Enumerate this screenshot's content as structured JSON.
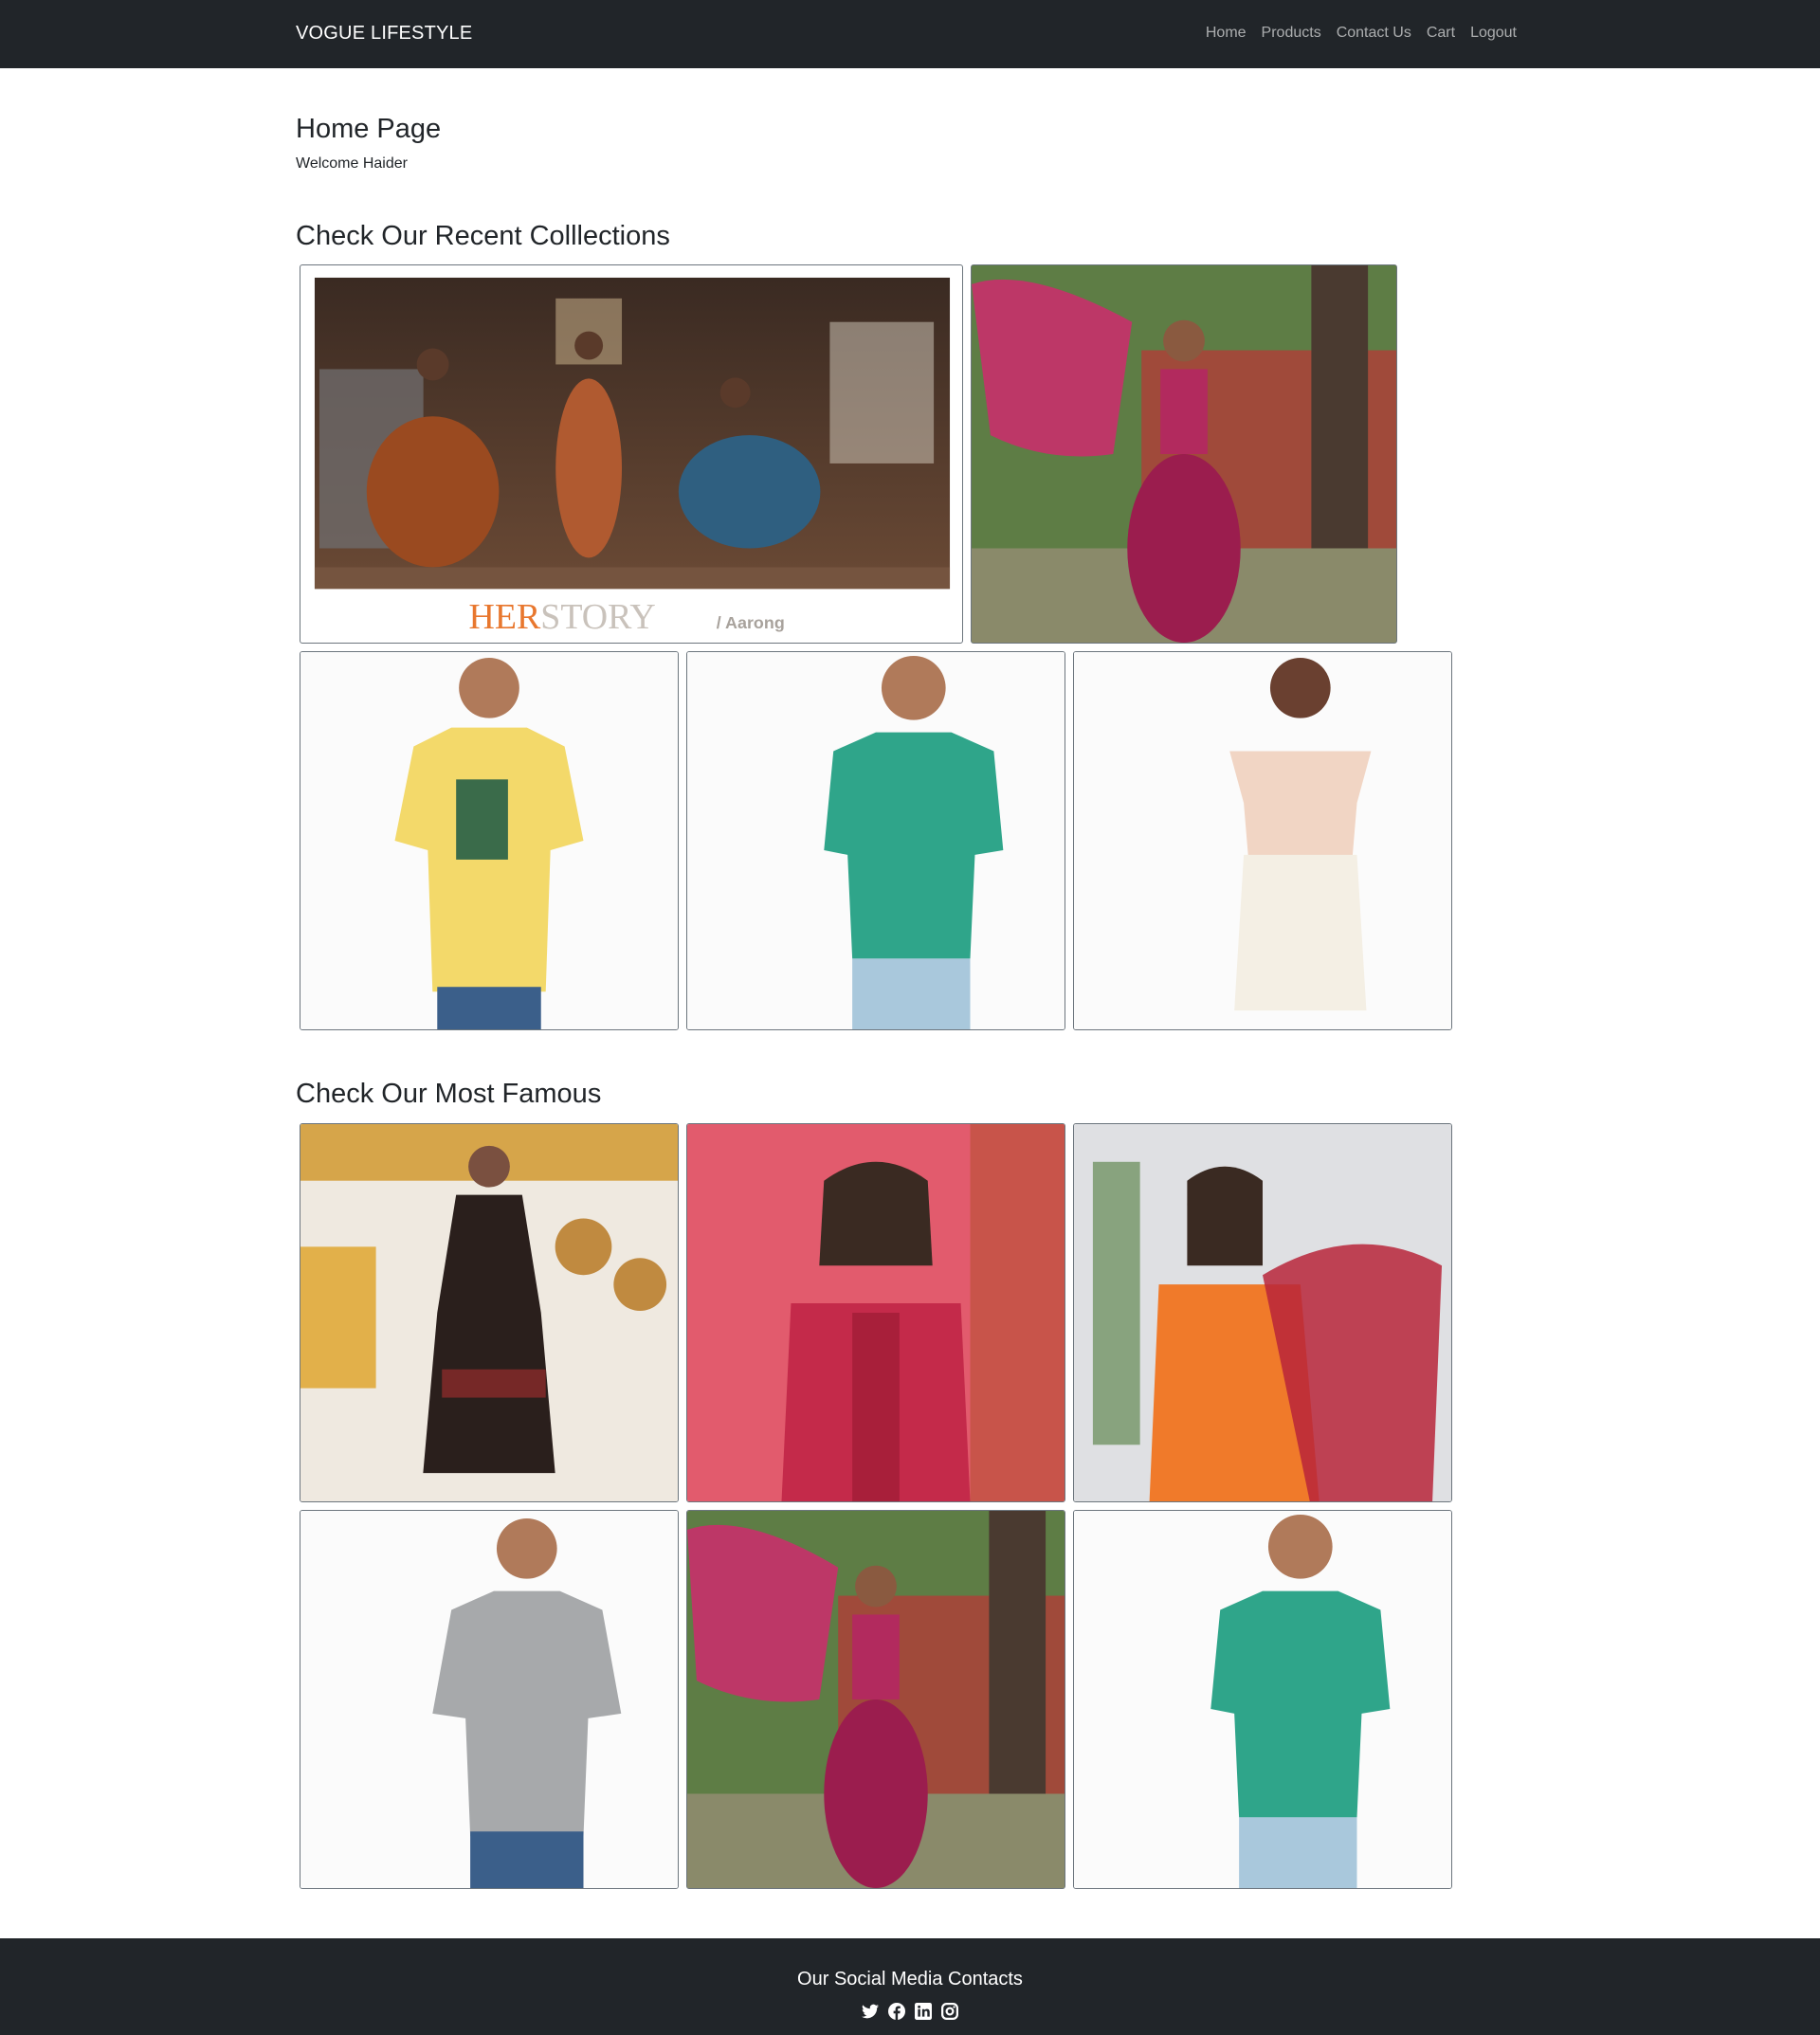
{
  "navbar": {
    "brand": "VOGUE LIFESTYLE",
    "links": [
      "Home",
      "Products",
      "Contact Us",
      "Cart",
      "Logout"
    ]
  },
  "page": {
    "title": "Home Page",
    "welcome": "Welcome Haider"
  },
  "recent": {
    "title": "Check Our Recent Colllections",
    "banner_brand": "HERSTORY",
    "banner_sub": "Aarong"
  },
  "famous": {
    "title": "Check Our Most Famous"
  },
  "footer": {
    "title": "Our Social Media Contacts",
    "icons": [
      "twitter-icon",
      "facebook-icon",
      "linkedin-icon",
      "instagram-icon"
    ]
  },
  "colors": {
    "navbar_bg": "#212529",
    "footer_bg": "#212529",
    "text": "#212529",
    "banner_orange": "#e8772e"
  }
}
